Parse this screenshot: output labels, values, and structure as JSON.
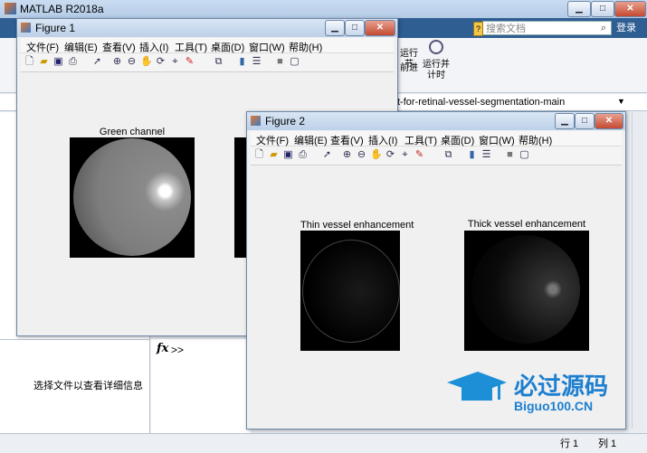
{
  "main": {
    "title": "MATLAB R2018a",
    "search_placeholder": "搜索文档",
    "login": "登录",
    "ribbon_btn1": "运行节",
    "ribbon_btn2": "前进",
    "ribbon_btn3": "运行并\n计时",
    "path": "t-for-retinal-vessel-segmentation-main",
    "detail_text": "选择文件以查看详细信息",
    "prompt": "fx >>",
    "status_row": "行  1",
    "status_col": "列  1"
  },
  "figure1": {
    "title": "Figure 1",
    "menu": [
      "文件(F)",
      "编辑(E)",
      "查看(V)",
      "插入(I)",
      "工具(T)",
      "桌面(D)",
      "窗口(W)",
      "帮助(H)"
    ],
    "axes_title": "Green channel"
  },
  "figure2": {
    "title": "Figure 2",
    "menu": [
      "文件(F)",
      "编辑(E)",
      "查看(V)",
      "插入(I)",
      "工具(T)",
      "桌面(D)",
      "窗口(W)",
      "帮助(H)"
    ],
    "axes1_title": "Thin vessel enhancement",
    "axes2_title": "Thick vessel enhancement"
  },
  "watermark": {
    "cn": "必过源码",
    "en": "Biguo100.CN"
  },
  "icons": [
    "new-file-icon",
    "open-folder-icon",
    "save-icon",
    "print-icon",
    "pointer-icon",
    "zoom-in-icon",
    "zoom-out-icon",
    "pan-icon",
    "rotate-icon",
    "data-cursor-icon",
    "brush-icon",
    "link-icon",
    "colorbar-icon",
    "legend-icon",
    "hide-icon",
    "show-icon"
  ]
}
